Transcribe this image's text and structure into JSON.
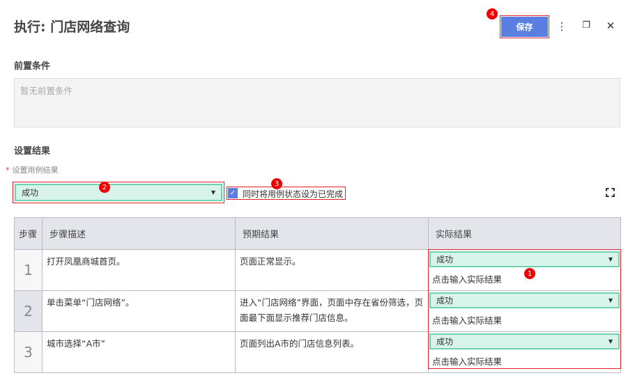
{
  "title": "执行: 门店网络查询",
  "toolbar": {
    "save_label": "保存",
    "more": "⋮",
    "restore": "❐",
    "close": "✕"
  },
  "precondition": {
    "heading": "前置条件",
    "placeholder": "暂无前置条件"
  },
  "result": {
    "heading": "设置结果",
    "required_mark": "*",
    "field_label": "设置用例结果",
    "selected": "成功",
    "checkbox_label": "同时将用例状态设为已完成",
    "checked": true
  },
  "table": {
    "headers": [
      "步骤",
      "步骤描述",
      "预期结果",
      "实际结果"
    ],
    "rows": [
      {
        "step": "1",
        "desc": "打开凤凰商城首页。",
        "expected": "页面正常显示。",
        "status": "成功",
        "input_placeholder": "点击输入实际结果"
      },
      {
        "step": "2",
        "desc": "单击菜单“门店网络”。",
        "expected": "进入“门店网络”界面，页面中存在省份筛选，页面最下面显示推荐门店信息。",
        "status": "成功",
        "input_placeholder": "点击输入实际结果"
      },
      {
        "step": "3",
        "desc": "城市选择“A市”",
        "expected": "页面列出A市的门店信息列表。",
        "status": "成功",
        "input_placeholder": "点击输入实际结果"
      }
    ]
  },
  "badges": [
    "1",
    "2",
    "3",
    "4"
  ]
}
